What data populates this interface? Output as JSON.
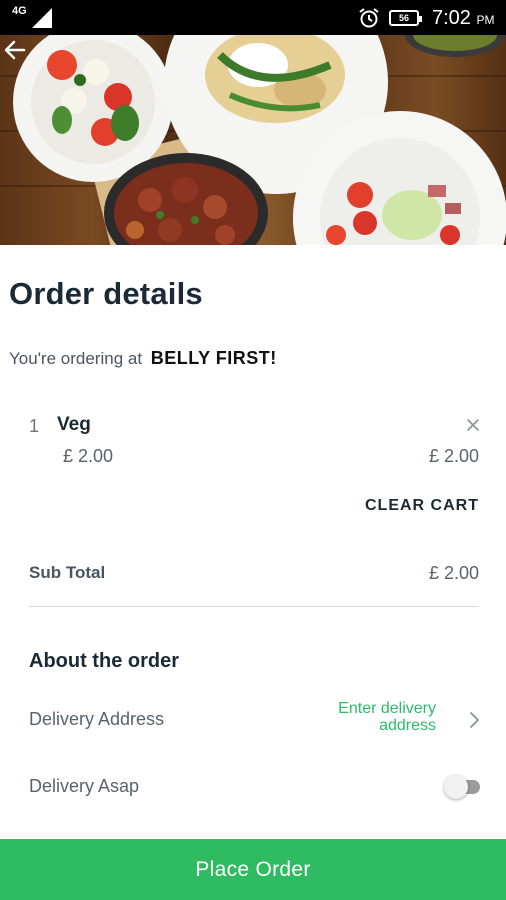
{
  "status_bar": {
    "network": "4G",
    "battery": "56",
    "time": "7:02",
    "ampm": "PM"
  },
  "header": {
    "title": "Order details",
    "ordering_prefix": "You're ordering at",
    "store_name": "BELLY FIRST!"
  },
  "cart": {
    "items": [
      {
        "qty": "1",
        "name": "Veg",
        "unit_price": "£ 2.00",
        "line_price": "£ 2.00"
      }
    ],
    "clear_cart_label": "CLEAR CART",
    "subtotal_label": "Sub Total",
    "subtotal_value": "£ 2.00"
  },
  "about": {
    "title": "About the order",
    "delivery_address_label": "Delivery Address",
    "delivery_address_value": "Enter delivery address",
    "delivery_asap_label": "Delivery Asap",
    "delivery_asap_on": false
  },
  "footer": {
    "place_order_label": "Place Order"
  },
  "colors": {
    "accent": "#2fbb62",
    "link": "#2dbb6a",
    "title": "#1b2a36"
  },
  "icons": {
    "back": "arrow-left-icon",
    "remove": "close-icon",
    "chevron": "chevron-right-icon",
    "alarm": "alarm-icon",
    "signal": "signal-icon",
    "battery": "battery-icon"
  }
}
